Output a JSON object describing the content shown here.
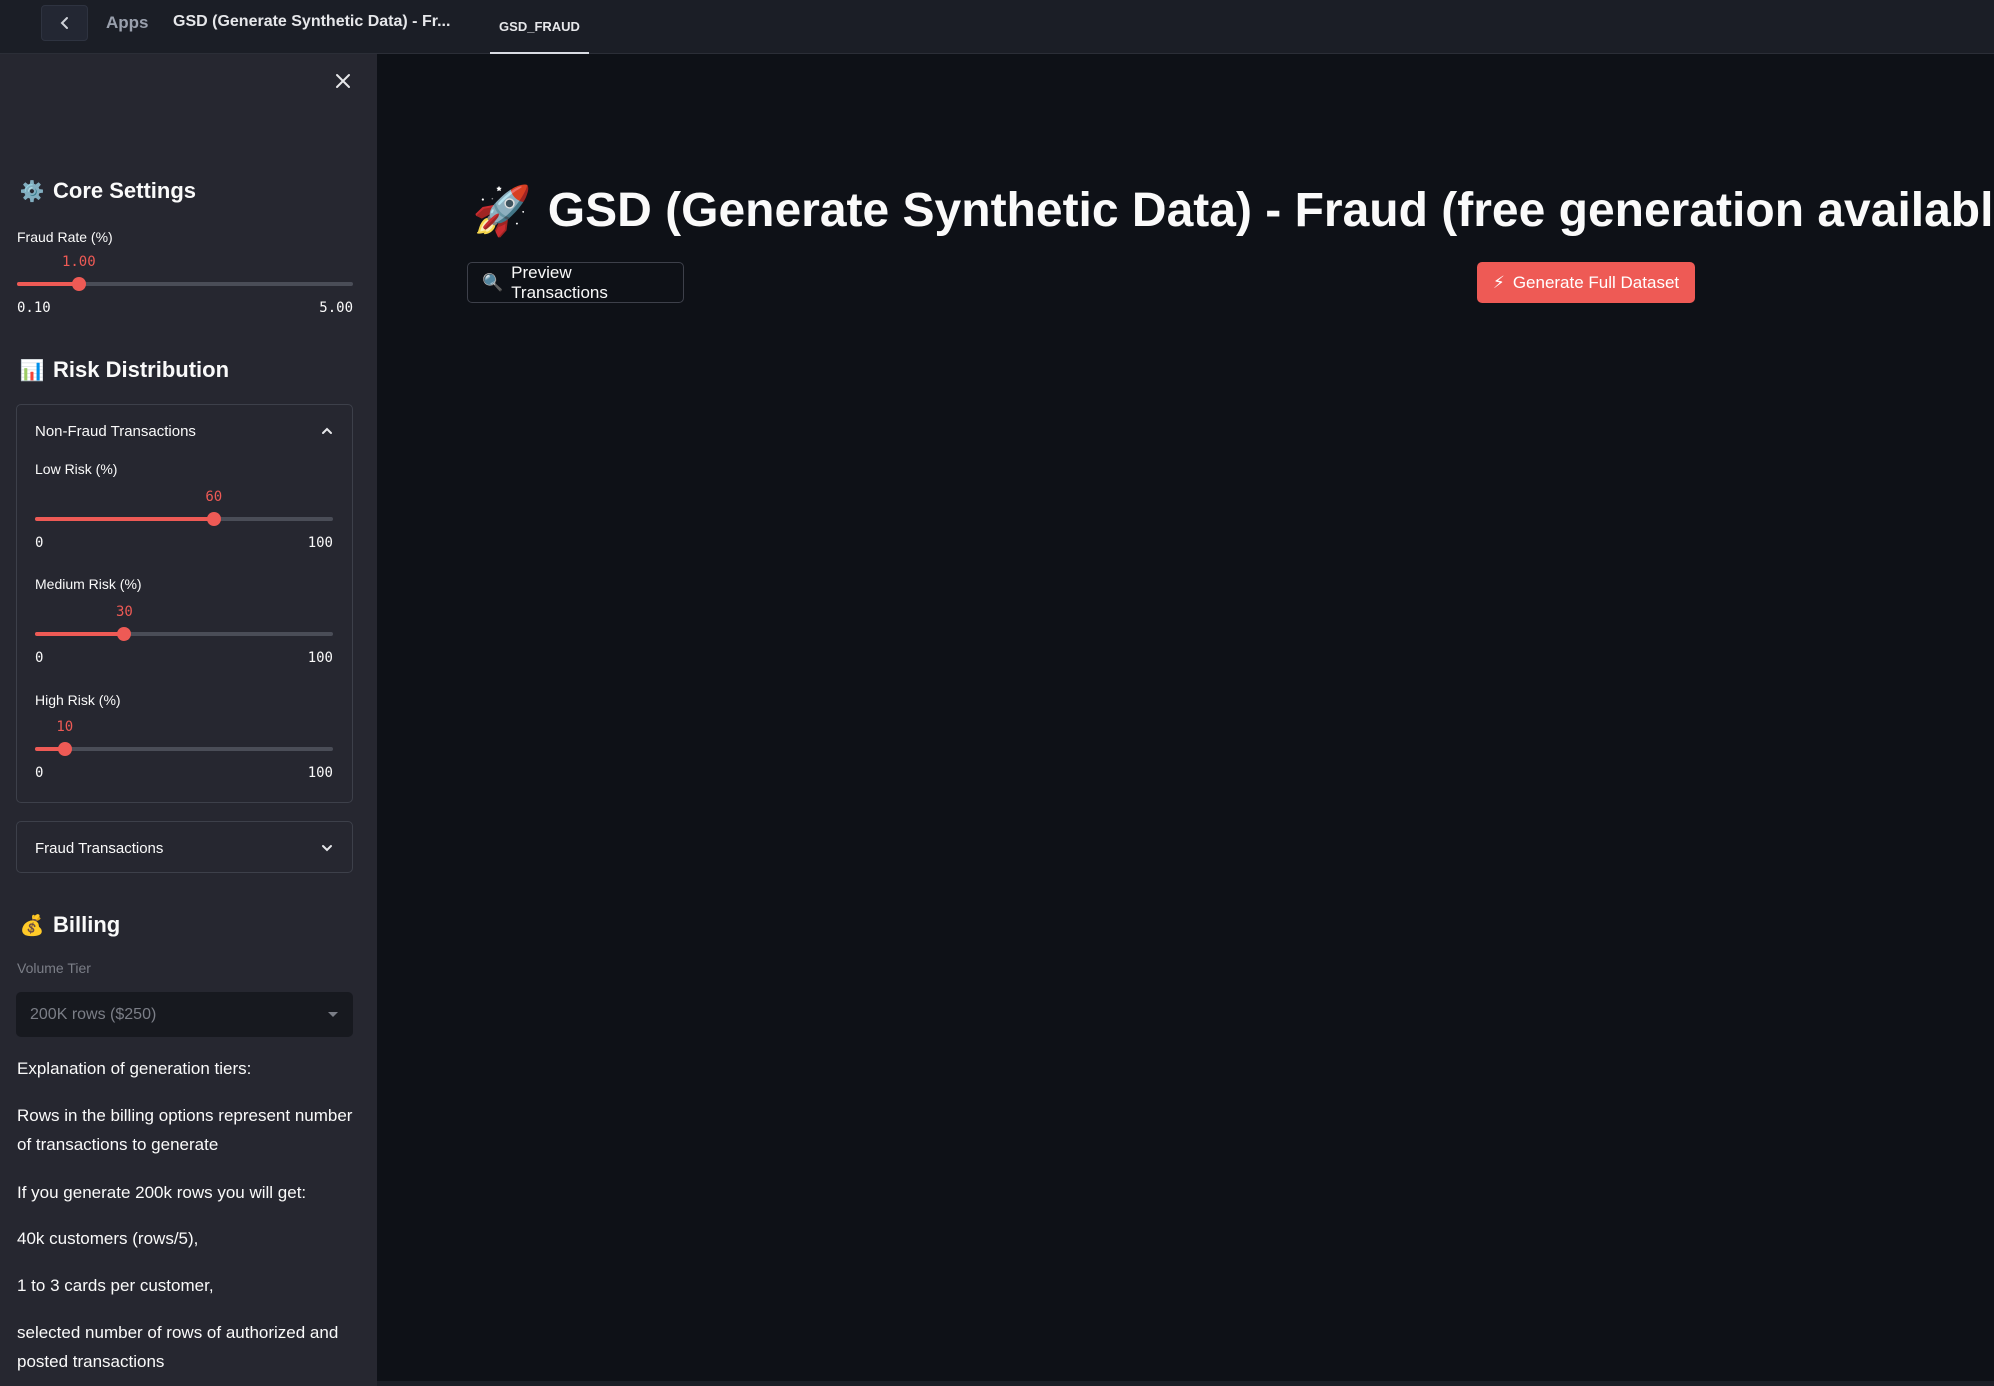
{
  "topbar": {
    "apps_label": "Apps",
    "page_title": "GSD (Generate Synthetic Data) - Fr...",
    "active_tab": "GSD_FRAUD"
  },
  "sidebar": {
    "core": {
      "header": "Core Settings",
      "emoji": "⚙️",
      "fraud_rate": {
        "label": "Fraud Rate (%)",
        "value": "1.00",
        "min": "0.10",
        "max": "5.00",
        "fraction": 0.184
      }
    },
    "risk": {
      "header": "Risk Distribution",
      "emoji": "📊",
      "non_fraud": {
        "title": "Non-Fraud Transactions",
        "low": {
          "label": "Low Risk (%)",
          "value": "60",
          "min": "0",
          "max": "100",
          "fraction": 0.6
        },
        "medium": {
          "label": "Medium Risk (%)",
          "value": "30",
          "min": "0",
          "max": "100",
          "fraction": 0.3
        },
        "high": {
          "label": "High Risk (%)",
          "value": "10",
          "min": "0",
          "max": "100",
          "fraction": 0.1
        }
      },
      "fraud": {
        "title": "Fraud Transactions"
      }
    },
    "billing": {
      "header": "Billing",
      "emoji": "💰",
      "volume_label": "Volume Tier",
      "volume_value": "200K rows ($250)",
      "p1": "Explanation of generation tiers:",
      "p2": "Rows in the billing options represent number of transactions to generate",
      "p3": "If you generate 200k rows you will get:",
      "p4": "40k customers (rows/5),",
      "p5": "1 to 3 cards per customer,",
      "p6": "selected number of rows of authorized and posted transactions"
    }
  },
  "main": {
    "title_emoji": "🚀",
    "title": "GSD (Generate Synthetic Data) - Fraud (free generation available)",
    "preview_button": {
      "icon": "🔍",
      "label": "Preview Transactions"
    },
    "generate_button": {
      "icon": "⚡",
      "label": "Generate Full Dataset"
    }
  },
  "colors": {
    "accent": "#ee5a55",
    "sidebar_bg": "#262730",
    "main_bg": "#0e1117"
  }
}
